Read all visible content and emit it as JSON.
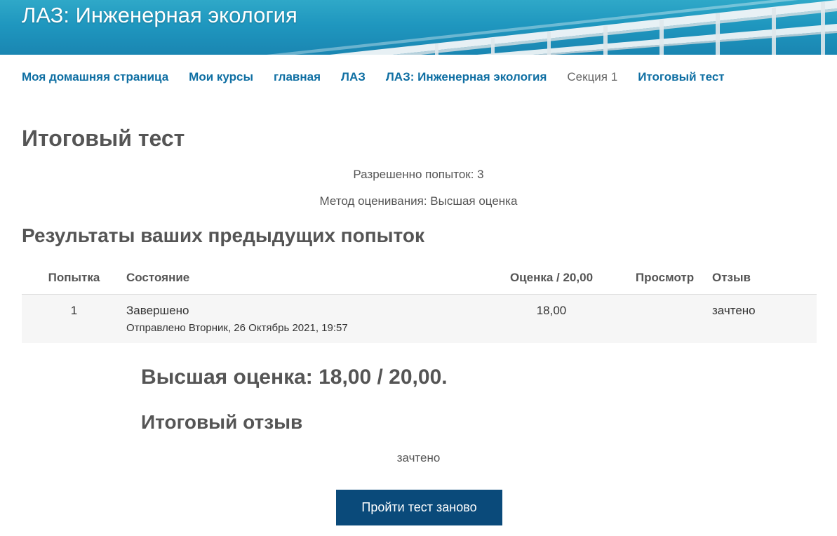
{
  "site": {
    "title": "ЛАЗ: Инженерная экология"
  },
  "breadcrumb": [
    {
      "label": "Моя домашняя страница",
      "link": true
    },
    {
      "label": "Мои курсы",
      "link": true
    },
    {
      "label": "главная",
      "link": true
    },
    {
      "label": "ЛАЗ",
      "link": true
    },
    {
      "label": "ЛАЗ: Инженерная экология",
      "link": true
    },
    {
      "label": "Секция 1",
      "link": false
    },
    {
      "label": "Итоговый тест",
      "link": true
    }
  ],
  "page": {
    "title": "Итоговый тест",
    "attempts_allowed": "Разрешенно попыток: 3",
    "grading_method": "Метод оценивания: Высшая оценка"
  },
  "results": {
    "title": "Результаты ваших предыдущих попыток",
    "headers": {
      "attempt": "Попытка",
      "state": "Состояние",
      "grade": "Оценка / 20,00",
      "review": "Просмотр",
      "feedback": "Отзыв"
    },
    "rows": [
      {
        "attempt": "1",
        "state": "Завершено",
        "submitted": "Отправлено Вторник, 26 Октябрь 2021, 19:57",
        "grade": "18,00",
        "review": "",
        "feedback": "зачтено"
      }
    ]
  },
  "summary": {
    "best_grade": "Высшая оценка: 18,00 / 20,00.",
    "overall_feedback_title": "Итоговый отзыв",
    "overall_feedback_text": "зачтено"
  },
  "actions": {
    "retake_label": "Пройти тест заново"
  },
  "colors": {
    "link": "#0f6fa3",
    "button": "#0a4a7a",
    "text": "#555555",
    "banner": "#1f97bf"
  }
}
